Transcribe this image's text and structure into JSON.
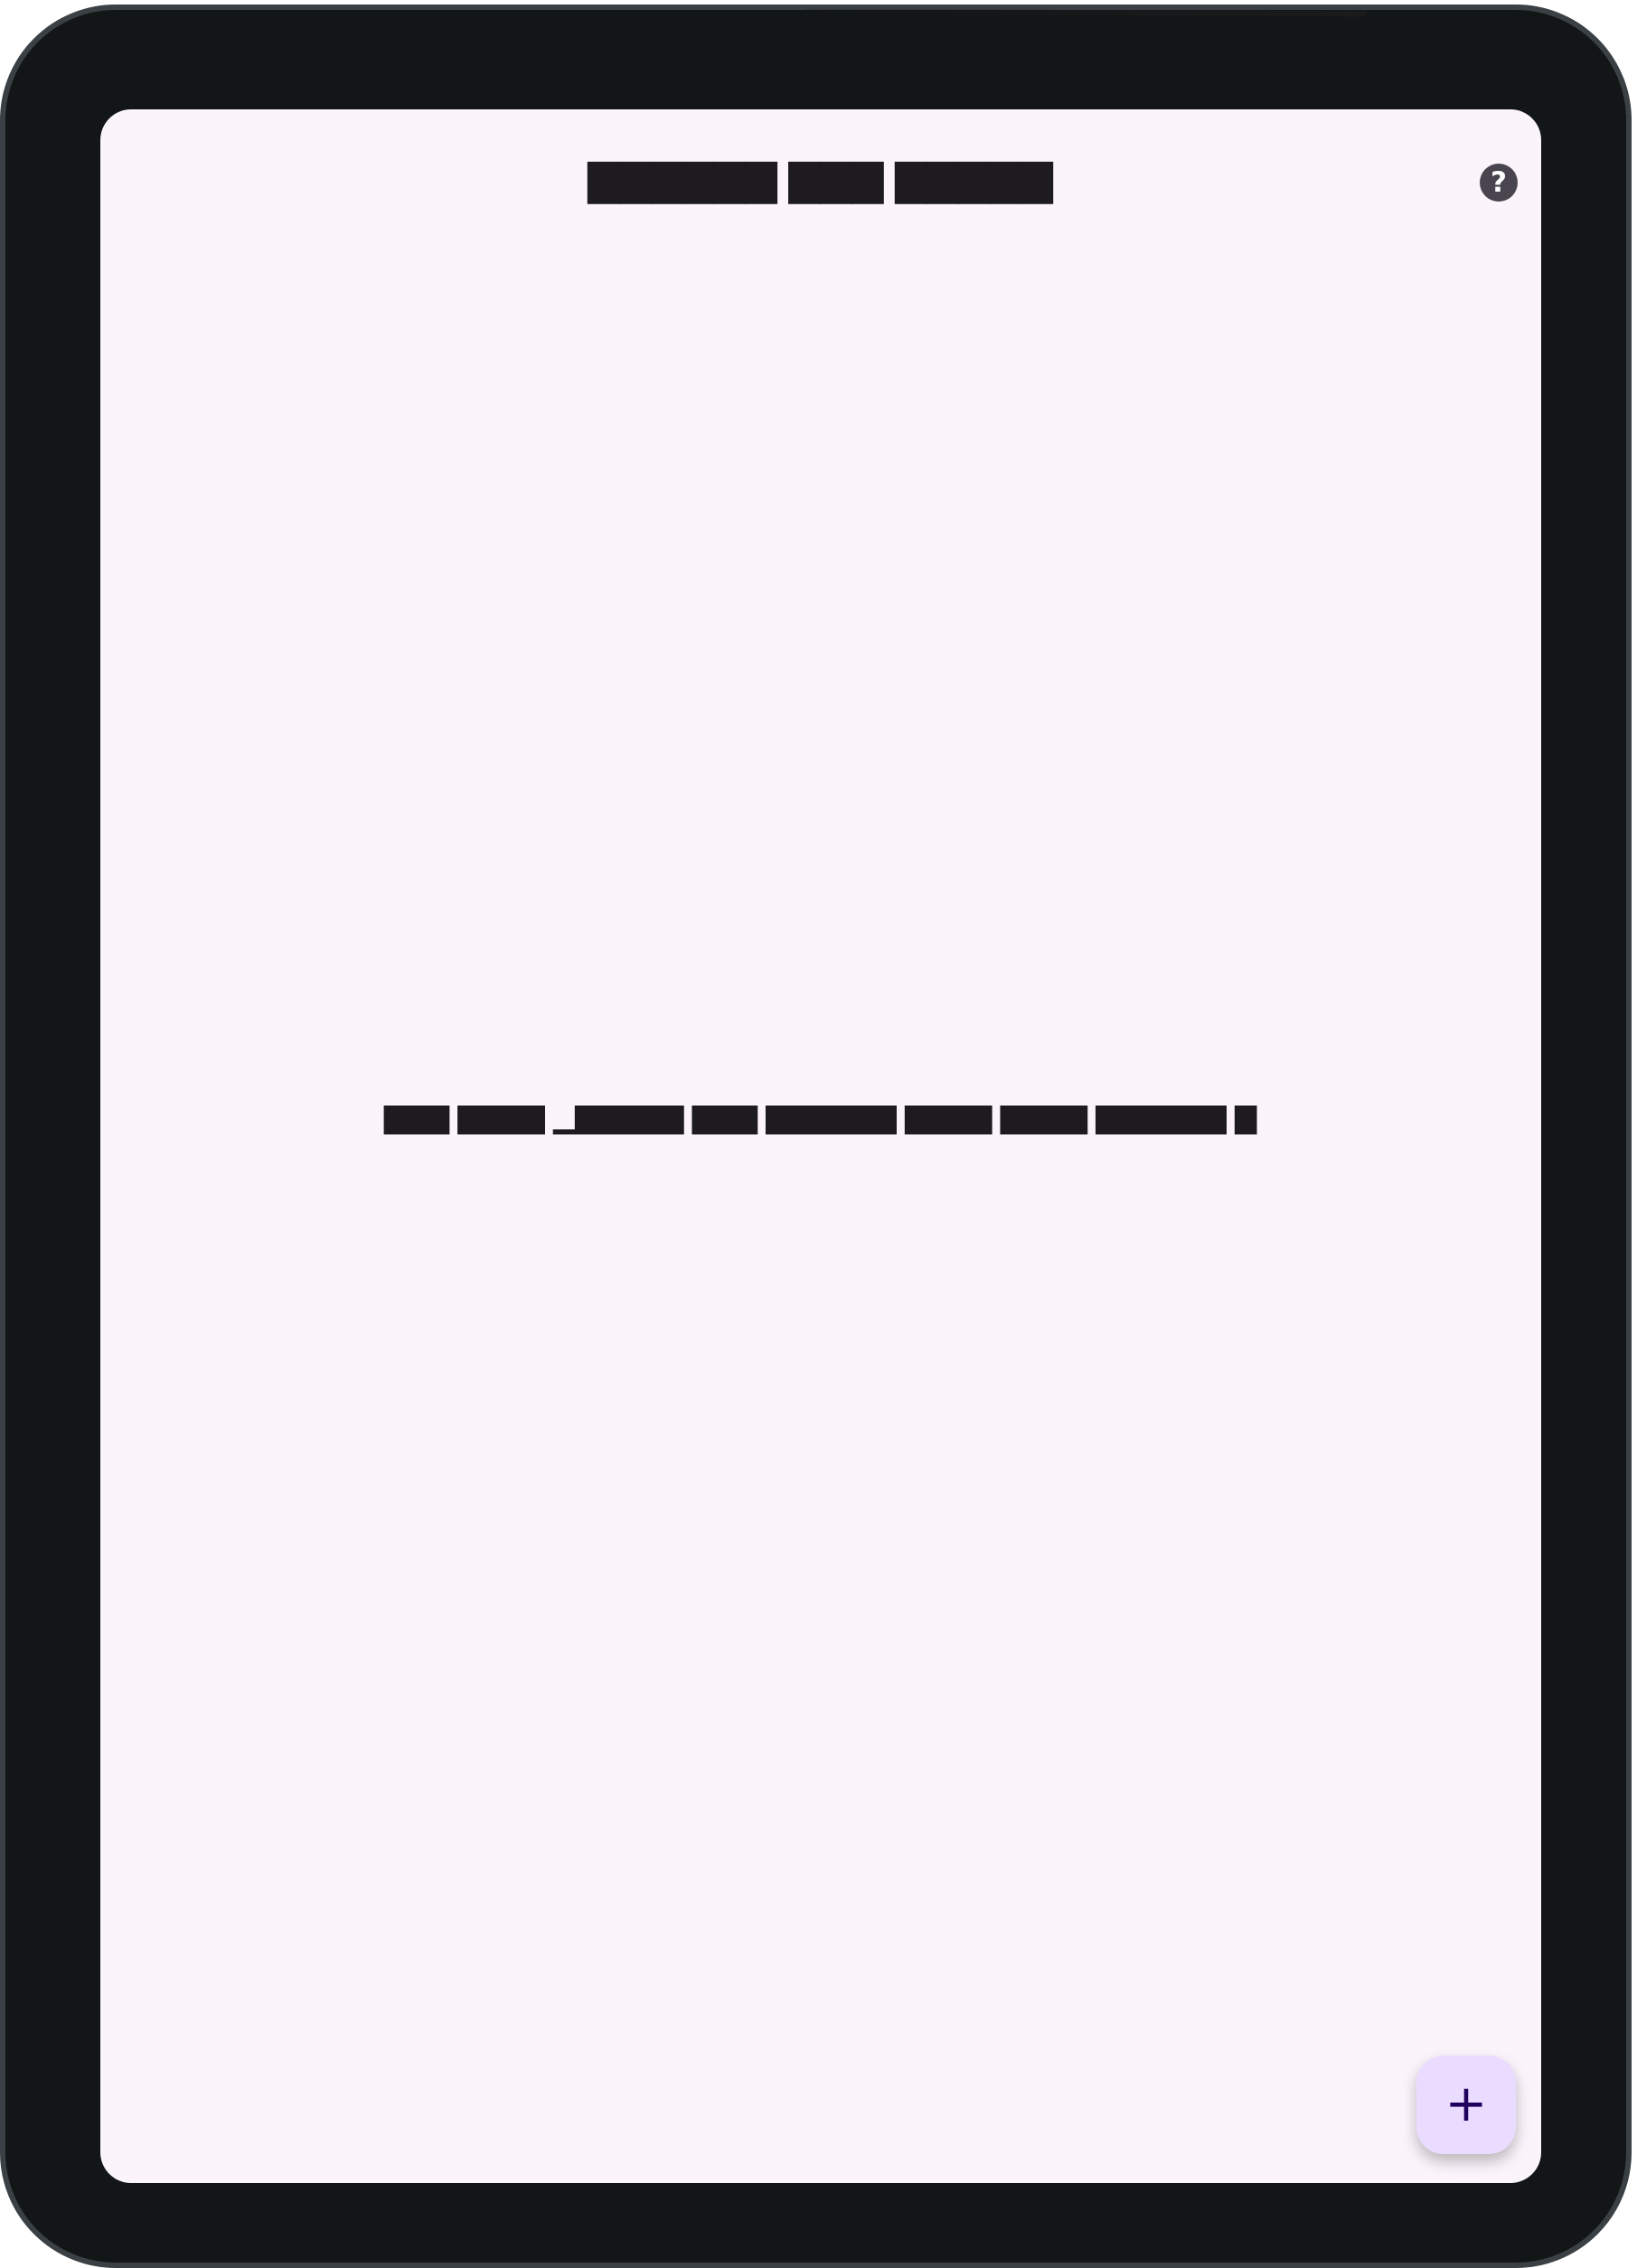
{
  "app": {
    "title": "▇▇▇▇▇▇ ▇▇▇ ▇▇▇▇▇"
  },
  "toolbar": {
    "help_icon": "help-icon",
    "help_label": "?"
  },
  "main": {
    "empty_message": "▇▇▇ ▇▇▇▇ ▁▇▇▇▇▇ ▇▇▇ ▇▇▇▇▇▇ ▇▇▇▇ ▇▇▇▇ ▇▇▇▇▇▇ ▇"
  },
  "fab": {
    "add_icon": "plus-icon",
    "add_label": "+"
  },
  "colors": {
    "device_frame": "#121617",
    "screen_background": "#fcf4fb",
    "text": "#1d1b20",
    "fab_background": "#eadcff",
    "fab_icon": "#21005d"
  }
}
